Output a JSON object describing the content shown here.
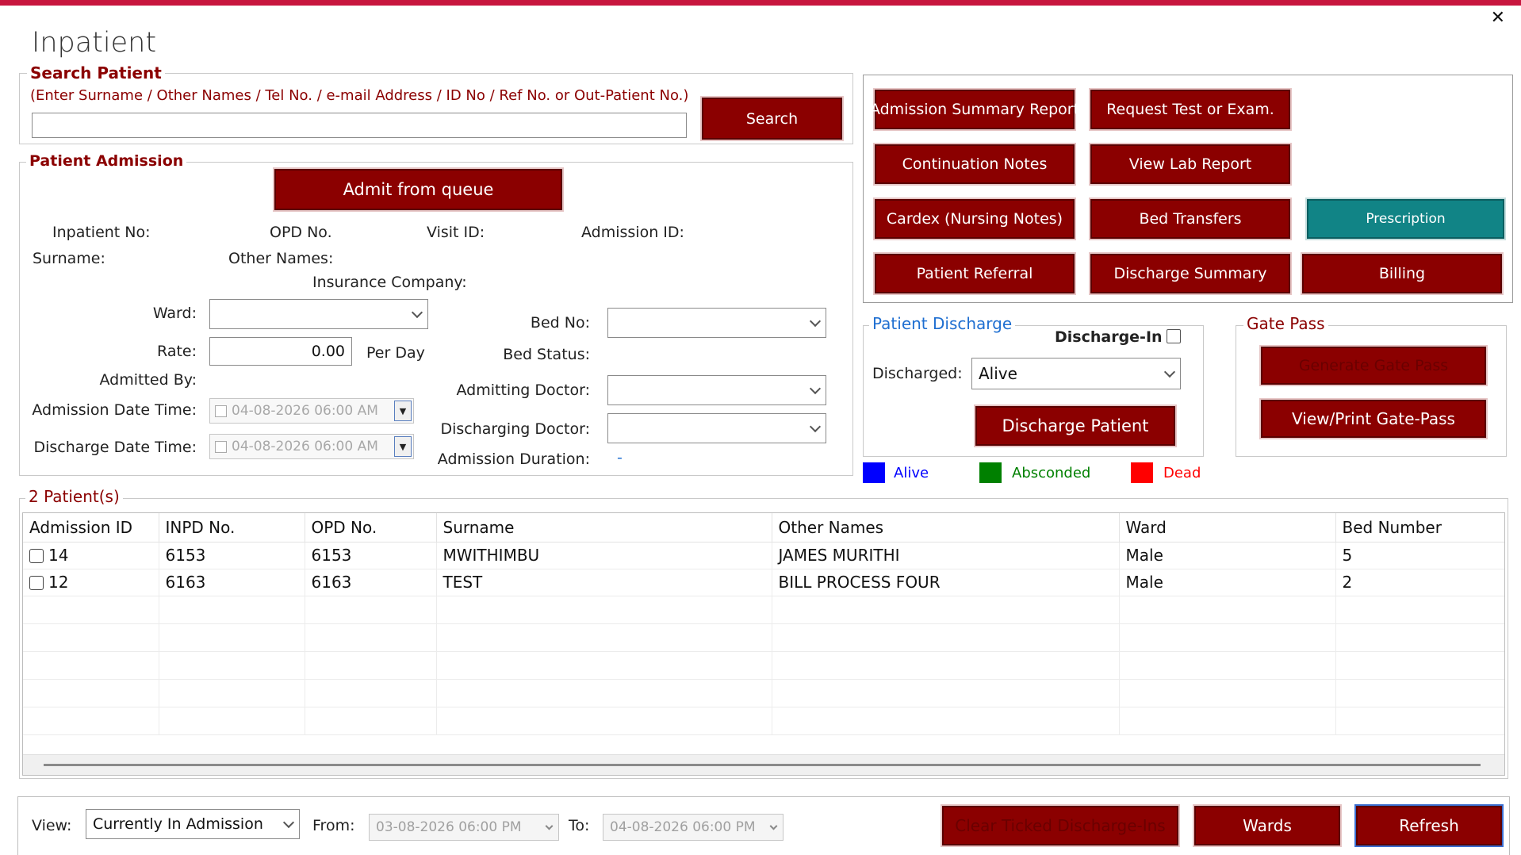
{
  "window": {
    "title": "Inpatient",
    "close_icon": "close-icon"
  },
  "search": {
    "legend": "Search Patient",
    "hint": "(Enter Surname / Other Names / Tel No. / e-mail Address / ID No / Ref No. or Out-Patient No.)",
    "value": "",
    "button": "Search"
  },
  "actions": {
    "admission_summary_report": "Admission Summary Report",
    "request_test": "Request Test or Exam.",
    "continuation_notes": "Continuation Notes",
    "view_lab_report": "View Lab Report",
    "cardex": "Cardex (Nursing Notes)",
    "bed_transfers": "Bed Transfers",
    "prescription": "Prescription",
    "patient_referral": "Patient Referral",
    "discharge_summary": "Discharge Summary",
    "billing": "Billing"
  },
  "admission": {
    "legend": "Patient Admission",
    "admit_button": "Admit from queue",
    "inpatient_no_label": "Inpatient No:",
    "opd_no_label": "OPD No.",
    "visit_id_label": "Visit ID:",
    "admission_id_label": "Admission ID:",
    "surname_label": "Surname:",
    "other_names_label": "Other Names:",
    "insurance_label": "Insurance Company:",
    "ward_label": "Ward:",
    "ward_value": "",
    "rate_label": "Rate:",
    "rate_value": "0.00",
    "per_day": "Per Day",
    "admitted_by_label": "Admitted By:",
    "admission_dt_label": "Admission Date Time:",
    "admission_dt_value": "04-08-2026  06:00 AM",
    "discharge_dt_label": "Discharge Date Time:",
    "discharge_dt_value": "04-08-2026  06:00 AM",
    "bed_no_label": "Bed No:",
    "bed_no_value": "",
    "bed_status_label": "Bed Status:",
    "admitting_doctor_label": "Admitting Doctor:",
    "discharging_doctor_label": "Discharging Doctor:",
    "duration_label": "Admission Duration:",
    "duration_value": "-"
  },
  "discharge": {
    "legend": "Patient Discharge",
    "discharge_in_label": "Discharge-In",
    "discharged_label": "Discharged:",
    "discharged_value": "Alive",
    "discharge_button": "Discharge Patient"
  },
  "gatepass": {
    "legend": "Gate Pass",
    "generate": "Generate Gate Pass",
    "view_print": "View/Print Gate-Pass"
  },
  "status_legend": {
    "alive": "Alive",
    "alive_color": "#0000ff",
    "absconded": "Absconded",
    "absconded_color": "#008000",
    "dead": "Dead",
    "dead_color": "#ff0000"
  },
  "patients": {
    "legend": "2 Patient(s)",
    "columns": [
      "Admission ID",
      "INPD No.",
      "OPD No.",
      "Surname",
      "Other Names",
      "Ward",
      "Bed Number"
    ],
    "rows": [
      {
        "admission_id": "14",
        "inpd_no": "6153",
        "opd_no": "6153",
        "surname": "MWITHIMBU",
        "other_names": "JAMES MURITHI",
        "ward": "Male",
        "bed": "5"
      },
      {
        "admission_id": "12",
        "inpd_no": "6163",
        "opd_no": "6163",
        "surname": "TEST",
        "other_names": "BILL PROCESS FOUR",
        "ward": "Male",
        "bed": "2"
      }
    ]
  },
  "footer": {
    "view_label": "View:",
    "view_value": "Currently In Admission",
    "from_label": "From:",
    "from_value": "03-08-2026  06:00 PM",
    "to_label": "To:",
    "to_value": "04-08-2026  06:00 PM",
    "clear_button": "Clear Ticked Discharge-Ins",
    "wards_button": "Wards",
    "refresh_button": "Refresh"
  },
  "colors": {
    "accent": "#8b0000",
    "topbar": "#c8163e",
    "teal": "#118486"
  }
}
